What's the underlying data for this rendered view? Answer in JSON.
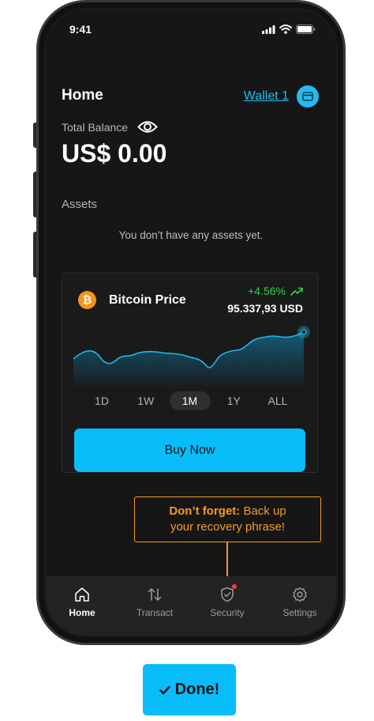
{
  "status": {
    "time": "9:41"
  },
  "header": {
    "title": "Home",
    "wallet_label": "Wallet 1"
  },
  "balance": {
    "label": "Total Balance",
    "value": "US$ 0.00"
  },
  "assets": {
    "label": "Assets",
    "empty_text": "You don’t have any assets yet."
  },
  "card": {
    "coin_symbol": "₿",
    "title": "Bitcoin Price",
    "change": "+4.56%",
    "price": "95.337,93 USD",
    "periods": [
      "1D",
      "1W",
      "1M",
      "1Y",
      "ALL"
    ],
    "active_period": "1M",
    "buy_label": "Buy Now",
    "accent": "#08bdf9",
    "positive_color": "#2fcf4a"
  },
  "tooltip": {
    "bold": "Don’t forget:",
    "text_1": " Back up",
    "text_2": "your recovery phrase!",
    "color": "#f39a24"
  },
  "tabs": [
    {
      "label": "Home",
      "icon": "home-icon"
    },
    {
      "label": "Transact",
      "icon": "transfer-arrows-icon"
    },
    {
      "label": "Security",
      "icon": "shield-check-icon"
    },
    {
      "label": "Settings",
      "icon": "gear-icon"
    }
  ],
  "done_button": {
    "label": "Done!",
    "icon": "checkmark-icon"
  }
}
